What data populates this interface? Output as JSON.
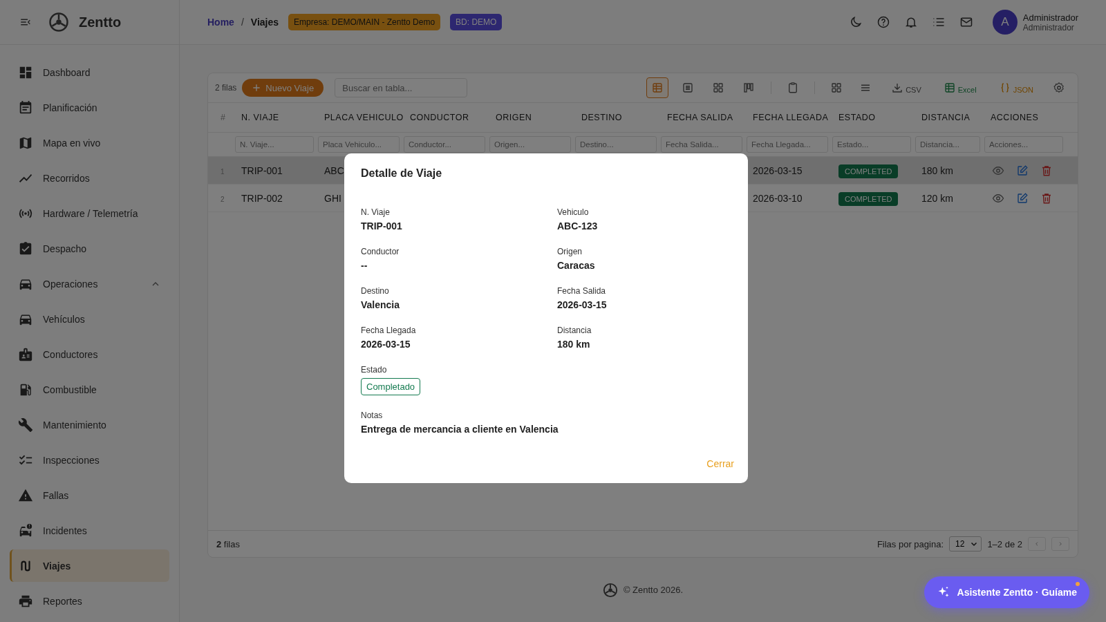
{
  "sidebar": {
    "logo": "Zentto",
    "items": [
      {
        "label": "Dashboard",
        "selected": false
      },
      {
        "label": "Planificación",
        "selected": false
      },
      {
        "label": "Mapa en vivo",
        "selected": false
      },
      {
        "label": "Recorridos",
        "selected": false
      },
      {
        "label": "Hardware / Telemetría",
        "selected": false
      },
      {
        "label": "Despacho",
        "selected": false
      },
      {
        "label": "Operaciones",
        "selected": false,
        "expanded": true,
        "children": [
          {
            "label": "Vehículos",
            "selected": false
          },
          {
            "label": "Conductores",
            "selected": false
          },
          {
            "label": "Combustible",
            "selected": false
          },
          {
            "label": "Mantenimiento",
            "selected": false
          },
          {
            "label": "Inspecciones",
            "selected": false
          },
          {
            "label": "Fallas",
            "selected": false
          },
          {
            "label": "Incidentes",
            "selected": false
          },
          {
            "label": "Viajes",
            "selected": true
          },
          {
            "label": "Reportes",
            "selected": false
          }
        ]
      }
    ]
  },
  "header": {
    "breadcrumb": [
      "Home",
      "Viajes"
    ],
    "breadcrumb_separator": "/",
    "company_badge": "Empresa: DEMO/MAIN - Zentto Demo",
    "db_badge": "BD: DEMO",
    "user": {
      "avatar": "A",
      "name": "Administrador",
      "role": "Administrador"
    }
  },
  "toolbar": {
    "count": "2 filas",
    "new_button": "Nuevo Viaje",
    "search": {
      "placeholder": "Buscar en tabla..."
    },
    "views": [
      {
        "selected": true
      },
      {
        "selected": false
      },
      {
        "selected": false
      },
      {
        "selected": false
      }
    ],
    "exports": [
      {
        "label": "CSV",
        "kind": "csv"
      },
      {
        "label": "Excel",
        "kind": "excel"
      },
      {
        "label": "JSON",
        "kind": "json"
      }
    ]
  },
  "table": {
    "columns": [
      "#",
      "N. VIAJE",
      "PLACA VEHICULO",
      "CONDUCTOR",
      "ORIGEN",
      "DESTINO",
      "FECHA SALIDA",
      "FECHA LLEGADA",
      "ESTADO",
      "DISTANCIA",
      "ACCIONES"
    ],
    "filters": [
      {
        "placeholder": "N. Viaje..."
      },
      {
        "placeholder": "Placa Vehiculo..."
      },
      {
        "placeholder": "Conductor..."
      },
      {
        "placeholder": "Origen..."
      },
      {
        "placeholder": "Destino..."
      },
      {
        "placeholder": "Fecha Salida..."
      },
      {
        "placeholder": "Fecha Llegada..."
      },
      {
        "placeholder": "Estado..."
      },
      {
        "placeholder": "Distancia..."
      },
      {
        "placeholder": "Acciones..."
      }
    ],
    "rows": [
      {
        "index": "1",
        "trip": "TRIP-001",
        "plate": "ABC",
        "arrival": "2026-03-15",
        "status": "COMPLETED",
        "distance": "180 km",
        "selected": true
      },
      {
        "index": "2",
        "trip": "TRIP-002",
        "plate": "GHI",
        "arrival": "2026-03-10",
        "status": "COMPLETED",
        "distance": "120 km",
        "selected": false
      }
    ]
  },
  "pagination": {
    "count": "**2** filas",
    "rows_per_page_label": "Filas por pagina:",
    "rows_per_page": "12",
    "range": "1–2 de 2"
  },
  "footer": {
    "copyright": "© Zentto 2026."
  },
  "dialog": {
    "title": "Detalle de Viaje",
    "fields": [
      {
        "label": "N. Viaje",
        "value": "TRIP-001"
      },
      {
        "label": "Vehiculo",
        "value": "ABC-123"
      },
      {
        "label": "Conductor",
        "value": "--"
      },
      {
        "label": "Origen",
        "value": "Caracas"
      },
      {
        "label": "Destino",
        "value": "Valencia"
      },
      {
        "label": "Fecha Salida",
        "value": "2026-03-15"
      },
      {
        "label": "Fecha Llegada",
        "value": "2026-03-15"
      },
      {
        "label": "Distancia",
        "value": "180 km"
      }
    ],
    "status": {
      "label": "Estado",
      "value": "Completado"
    },
    "notes": {
      "label": "Notas",
      "value": "Entrega de mercancia a cliente en Valencia"
    },
    "close_button": "Cerrar"
  },
  "assistant": {
    "label": "Asistente Zentto · Guíame",
    "notification": true
  }
}
